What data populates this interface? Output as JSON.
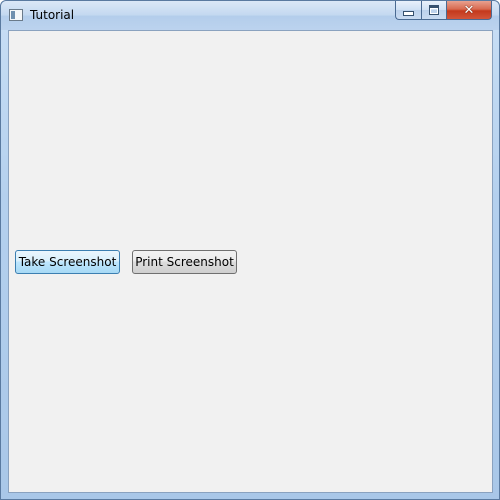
{
  "window": {
    "title": "Tutorial",
    "icon": "app-window-icon",
    "controls": {
      "minimize_icon": "minimize-icon",
      "maximize_icon": "maximize-icon",
      "close_icon": "close-icon",
      "close_glyph": "✕"
    }
  },
  "buttons": {
    "take_screenshot_label": "Take Screenshot",
    "print_screenshot_label": "Print Screenshot"
  },
  "colors": {
    "client_background": "#f1f1f1",
    "focused_button_border": "#3c7fb1",
    "close_button_red": "#c4391c"
  }
}
